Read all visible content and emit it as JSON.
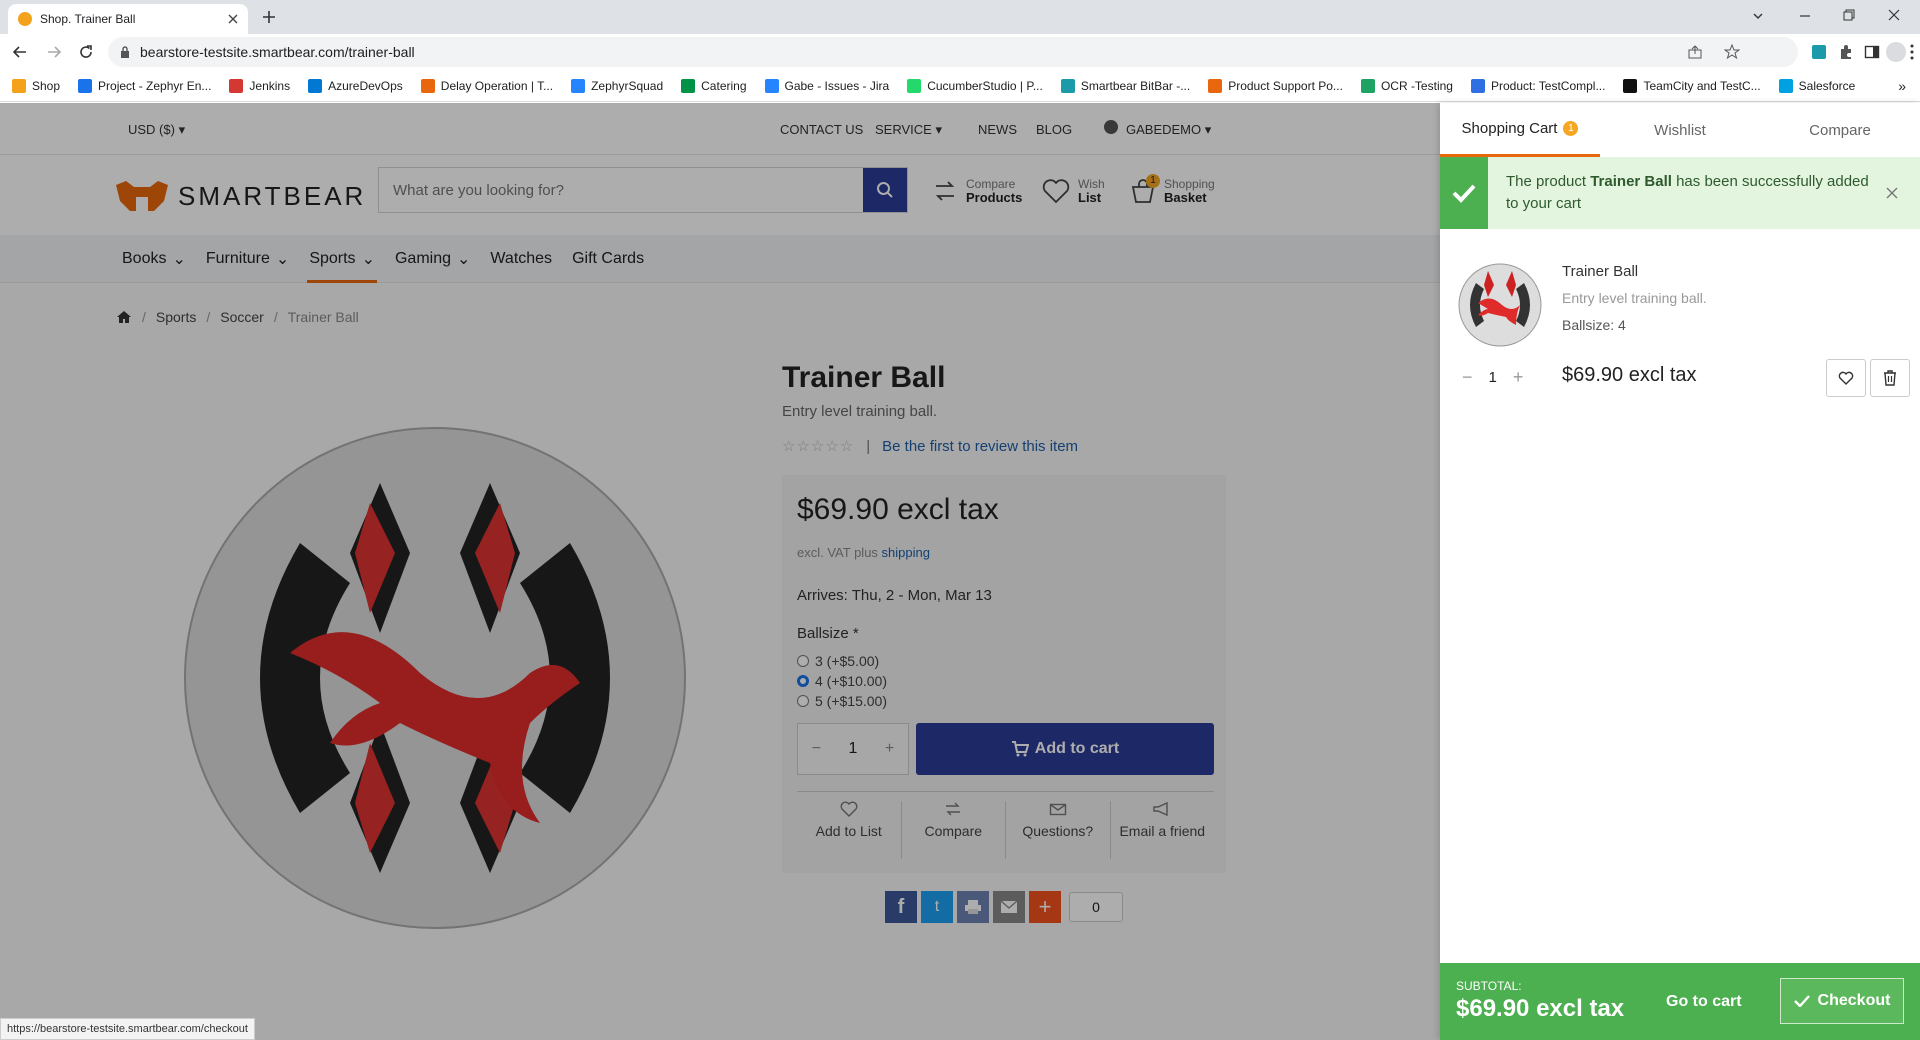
{
  "browser": {
    "tab_title": "Shop. Trainer Ball",
    "url": "bearstore-testsite.smartbear.com/trainer-ball",
    "bookmarks": [
      {
        "label": "Shop",
        "color": "#f4a21c"
      },
      {
        "label": "Project - Zephyr En...",
        "color": "#1a73e8"
      },
      {
        "label": "Jenkins",
        "color": "#d33833"
      },
      {
        "label": "AzureDevOps",
        "color": "#0078d4"
      },
      {
        "label": "Delay Operation | T...",
        "color": "#e8670c"
      },
      {
        "label": "ZephyrSquad",
        "color": "#2684ff"
      },
      {
        "label": "Catering",
        "color": "#009246"
      },
      {
        "label": "Gabe - Issues - Jira",
        "color": "#2684ff"
      },
      {
        "label": "CucumberStudio | P...",
        "color": "#23d96c"
      },
      {
        "label": "Smartbear BitBar -...",
        "color": "#1b9aaa"
      },
      {
        "label": "Product Support Po...",
        "color": "#e8670c"
      },
      {
        "label": "OCR -Testing",
        "color": "#1ea362"
      },
      {
        "label": "Product: TestCompl...",
        "color": "#2f6fe4"
      },
      {
        "label": "TeamCity and TestC...",
        "color": "#111111"
      },
      {
        "label": "Salesforce",
        "color": "#00a1e0"
      }
    ],
    "status_url": "https://bearstore-testsite.smartbear.com/checkout"
  },
  "topbar": {
    "currency": "USD  ($)",
    "links": [
      "CONTACT US",
      "SERVICE",
      "NEWS",
      "BLOG"
    ],
    "user": "GABEDEMO"
  },
  "header": {
    "logo_text": "SMARTBEAR",
    "search_placeholder": "What are you looking for?",
    "compare_top": "Compare",
    "compare_bottom": "Products",
    "wish_top": "Wish",
    "wish_bottom": "List",
    "basket_top": "Shopping",
    "basket_bottom": "Basket",
    "basket_count": "1"
  },
  "categories": [
    "Books",
    "Furniture",
    "Sports",
    "Gaming",
    "Watches",
    "Gift Cards"
  ],
  "breadcrumb": [
    "Sports",
    "Soccer",
    "Trainer Ball"
  ],
  "product": {
    "name": "Trainer Ball",
    "short_desc": "Entry level training ball.",
    "review_link": "Be the first to review this item",
    "price": "$69.90 excl tax",
    "vat_prefix": "excl. VAT plus",
    "vat_link": "shipping",
    "arrives_label": "Arrives:",
    "arrives_value": "Thu, 2 - Mon, Mar 13",
    "ballsize_label": "Ballsize *",
    "options": [
      "3 (+$5.00)",
      "4 (+$10.00)",
      "5 (+$15.00)"
    ],
    "selected_option": 1,
    "quantity": "1",
    "add_to_cart": "Add to cart",
    "actions": [
      "Add to List",
      "Compare",
      "Questions?",
      "Email a friend"
    ],
    "share_count": "0",
    "rating": 0
  },
  "cart": {
    "tabs": [
      "Shopping Cart",
      "Wishlist",
      "Compare"
    ],
    "cart_badge": "1",
    "alert_prefix": "The product",
    "alert_product": "Trainer Ball",
    "alert_suffix": "has been successfully added to your cart",
    "item_name": "Trainer Ball",
    "item_desc": "Entry level training ball.",
    "item_attr": "Ballsize: 4",
    "item_qty": "1",
    "item_price": "$69.90 excl tax",
    "subtotal_label": "SUBTOTAL:",
    "subtotal": "$69.90 excl tax",
    "go_to_cart": "Go to cart",
    "checkout": "Checkout"
  },
  "colors": {
    "accent": "#e8670c",
    "primary": "#2c3b97",
    "success": "#4caf50",
    "link": "#1f5fa8"
  }
}
